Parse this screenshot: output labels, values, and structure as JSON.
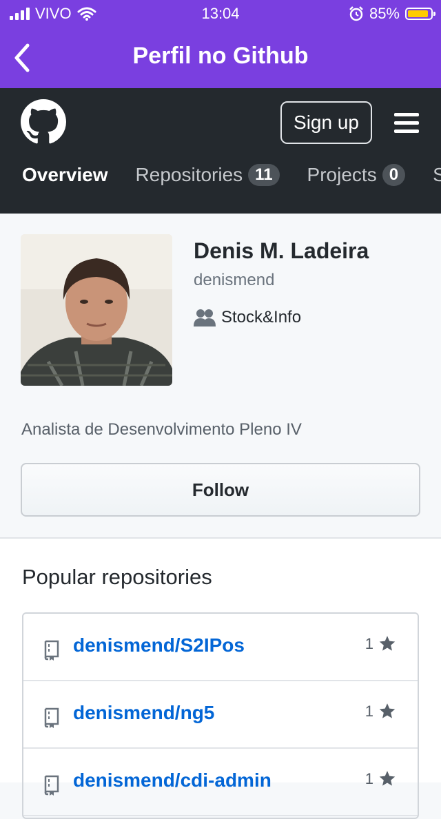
{
  "status_bar": {
    "carrier": "VIVO",
    "time": "13:04",
    "battery": "85%",
    "battery_level": 0.85
  },
  "navbar": {
    "title": "Perfil no Github"
  },
  "github_header": {
    "signup_label": "Sign up",
    "tabs": [
      {
        "label": "Overview",
        "count": null
      },
      {
        "label": "Repositories",
        "count": "11"
      },
      {
        "label": "Projects",
        "count": "0"
      }
    ],
    "tab_overflow": "S"
  },
  "profile": {
    "full_name": "Denis M. Ladeira",
    "login": "denismend",
    "organization": "Stock&Info",
    "bio": "Analista de Desenvolvimento Pleno IV",
    "follow_label": "Follow"
  },
  "popular": {
    "heading": "Popular repositories",
    "repos": [
      {
        "name": "denismend/S2IPos",
        "stars": "1"
      },
      {
        "name": "denismend/ng5",
        "stars": "1"
      },
      {
        "name": "denismend/cdi-admin",
        "stars": "1"
      }
    ]
  },
  "colors": {
    "nav_purple": "#7a3fe0",
    "github_dark": "#24292e",
    "link_blue": "#0366d6"
  }
}
